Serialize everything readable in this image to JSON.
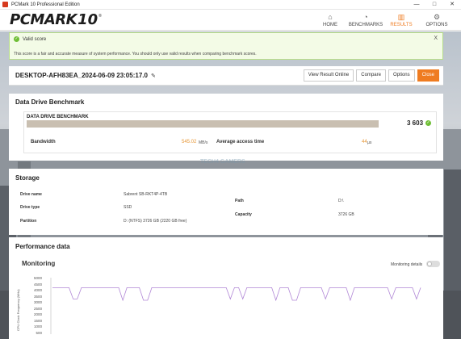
{
  "window": {
    "title": "PCMark 10 Professional Edition",
    "minimize": "—",
    "maximize": "□",
    "close": "✕"
  },
  "logo": {
    "brand": "PCMARK",
    "version": "10",
    "reg": "®"
  },
  "nav": [
    {
      "label": "HOME",
      "icon": "home-icon",
      "glyph": "⌂",
      "active": false
    },
    {
      "label": "BENCHMARKS",
      "icon": "gauge-icon",
      "glyph": "◔",
      "active": false
    },
    {
      "label": "RESULTS",
      "icon": "bar-chart-icon",
      "glyph": "▥",
      "active": true
    },
    {
      "label": "OPTIONS",
      "icon": "gear-icon",
      "glyph": "⚙",
      "active": false
    }
  ],
  "valid": {
    "title": "Valid score",
    "close": "X",
    "text": "This score is a fair and accurate measure of system performance. You should only use valid results when comparing benchmark scores."
  },
  "result": {
    "name": "DESKTOP-AFH83EA_2024-06-09 23:05:17.0",
    "buttons": {
      "view_online": "View Result Online",
      "compare": "Compare",
      "options": "Options",
      "close": "Close"
    }
  },
  "ddb": {
    "title": "Data Drive Benchmark",
    "card_label": "DATA DRIVE BENCHMARK",
    "score": "3 603",
    "bandwidth_label": "Bandwidth",
    "bandwidth_value": "545.02",
    "bandwidth_unit": "MB/s",
    "access_label": "Average access time",
    "access_value": "44",
    "access_unit": "µs"
  },
  "storage": {
    "title": "Storage",
    "drive_name_label": "Drive name",
    "drive_name": "Sabrent SB-RKT4P-4TB",
    "drive_type_label": "Drive type",
    "drive_type": "SSD",
    "partition_label": "Partition",
    "partition": "D: (NTFS) 3726 GB (2220 GB free)",
    "path_label": "Path",
    "path": "D:\\",
    "capacity_label": "Capacity",
    "capacity": "3726 GB"
  },
  "performance": {
    "title": "Performance data",
    "monitoring_title": "Monitoring",
    "monitoring_details": "Monitoring details",
    "monitoring_details_on": false,
    "y_axis_label": "CPU Clock Frequency (MHz)",
    "y_ticks": [
      "5000",
      "4500",
      "4000",
      "3500",
      "3000",
      "2500",
      "2000",
      "1500",
      "1000",
      "500"
    ]
  },
  "chart_data": {
    "type": "line",
    "title": "Monitoring",
    "ylabel": "CPU Clock Frequency (MHz)",
    "ylim": [
      500,
      5000
    ],
    "series": [
      {
        "color": "#b187d6",
        "values": [
          4200,
          4200,
          4200,
          4200,
          4200,
          3300,
          3300,
          4200,
          4200,
          4200,
          4200,
          4200,
          4200,
          4200,
          4200,
          4200,
          4200,
          3200,
          4200,
          4200,
          4200,
          4200,
          3200,
          3200,
          4200,
          4200,
          4200,
          4200,
          4200,
          4200,
          4200,
          4200,
          4200,
          4200,
          4200,
          4200,
          4200,
          4200,
          4200,
          4200,
          4200,
          4200,
          4200,
          3300,
          4200,
          4200,
          3300,
          4200,
          4200,
          4200,
          4200,
          4200,
          4200,
          4200,
          3200,
          4200,
          4200,
          4200,
          3200,
          3200,
          4200,
          4200,
          4200,
          4200,
          4200,
          4200,
          3300,
          4200,
          4200,
          4200,
          4200,
          4200,
          3200,
          4200,
          4200,
          4200,
          4200,
          4200,
          4200,
          4200,
          4200,
          4200,
          3300,
          4200,
          4200,
          4200,
          4200,
          4200,
          3300,
          4200
        ]
      }
    ],
    "colors": {
      "accent": "#ef7c21",
      "valid_green": "#6fbe36",
      "line": "#b187d6"
    }
  }
}
